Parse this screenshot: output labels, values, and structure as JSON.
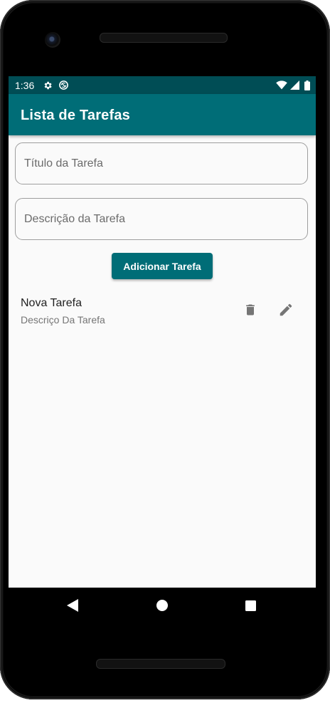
{
  "status_bar": {
    "time": "1:36",
    "icons": [
      "settings-icon",
      "sync-icon",
      "wifi-icon",
      "signal-icon",
      "battery-icon"
    ]
  },
  "app_bar": {
    "title": "Lista de Tarefas",
    "color": "#006d77"
  },
  "form": {
    "title_placeholder": "Título da Tarefa",
    "title_value": "",
    "description_placeholder": "Descrição da Tarefa",
    "description_value": "",
    "add_button_label": "Adicionar Tarefa"
  },
  "tasks": [
    {
      "title": "Nova Tarefa",
      "description": "Descriço Da Tarefa",
      "actions": [
        "delete-icon",
        "edit-icon"
      ]
    }
  ],
  "navigation": {
    "buttons": [
      "back-icon",
      "home-icon",
      "recents-icon"
    ]
  },
  "colors": {
    "primary": "#006d77",
    "primary_dark": "#004d55",
    "background": "#fafafa"
  }
}
